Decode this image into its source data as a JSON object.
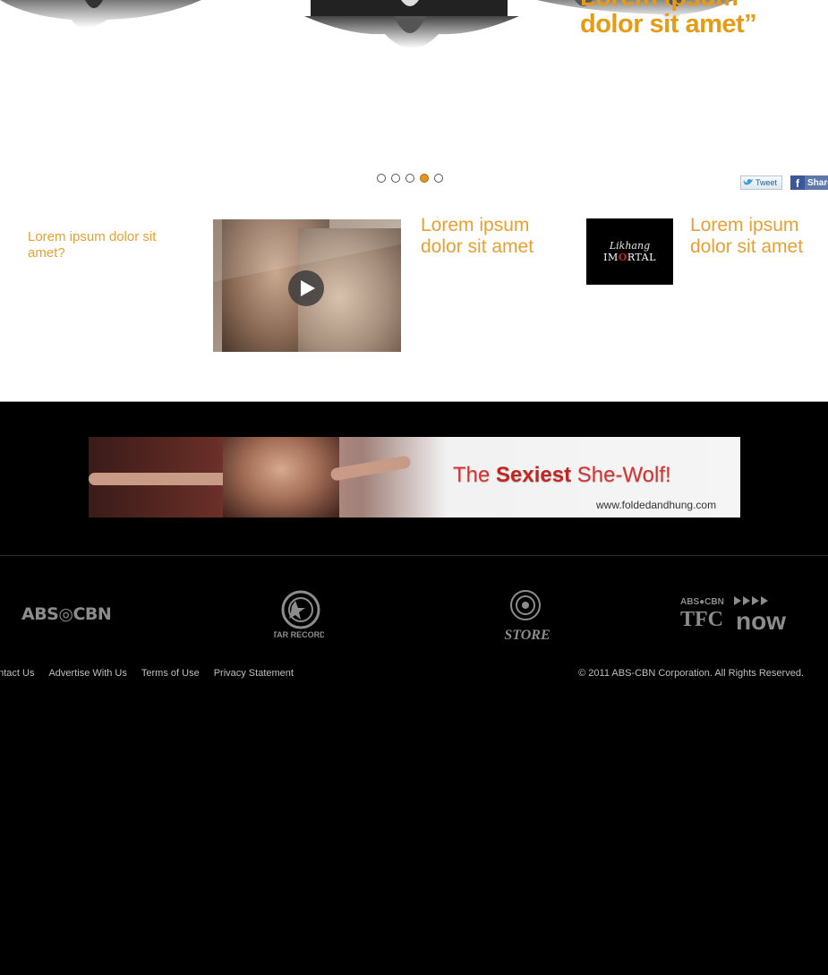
{
  "hero": {
    "quote_line1": "Lorem ipsum",
    "quote_line2": "dolor sit amet”"
  },
  "carousel": {
    "slide_count": 5,
    "active_index": 4,
    "accent_color": "#e8961a"
  },
  "social": {
    "tweet_label": "Tweet",
    "share_label": "Share",
    "fb_glyph": "f"
  },
  "features": {
    "small_heading": "Lorem ipsum dolor sit amet?",
    "video": {
      "heading_line1": "Lorem ipsum",
      "heading_line2": "dolor sit amet",
      "icon": "play-icon"
    },
    "show": {
      "logo_line1": "Likhang",
      "logo_line2_a": "IM",
      "logo_line2_b": "O",
      "logo_line2_c": "RTAL",
      "heading_line1": "Lorem ipsum",
      "heading_line2": "dolor sit amet"
    },
    "heading_color": "#e7a031"
  },
  "banner": {
    "tagline_the": "The ",
    "tagline_sexiest": "Sexiest",
    "tagline_rest": " She-Wolf!",
    "url": "www.foldedandhung.com"
  },
  "footer": {
    "logos": {
      "abs": "ABS◎CBN",
      "star": "STAR RECORDS",
      "store": "STORE",
      "tfc_now": "now"
    },
    "links": [
      "ontact Us",
      "Advertise With Us",
      "Terms of Use",
      "Privacy Statement"
    ],
    "copyright": "© 2011 ABS-CBN Corporation. All Rights Reserved."
  }
}
